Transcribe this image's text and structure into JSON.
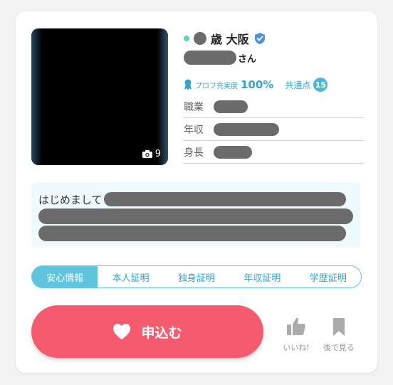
{
  "profile": {
    "age_location": "歳 大阪",
    "name_suffix": "さん",
    "photo_count": "9",
    "completeness_label": "プロフ充実度",
    "completeness_value": "100%",
    "common_label": "共通点",
    "common_count": "15",
    "attributes": [
      {
        "label": "職業"
      },
      {
        "label": "年収"
      },
      {
        "label": "身長"
      }
    ],
    "intro_start": "はじめまして"
  },
  "certifications": {
    "tabs": [
      {
        "label": "安心情報",
        "active": true
      },
      {
        "label": "本人証明",
        "active": false
      },
      {
        "label": "独身証明",
        "active": false
      },
      {
        "label": "年収証明",
        "active": false
      },
      {
        "label": "学歴証明",
        "active": false
      }
    ]
  },
  "actions": {
    "apply_label": "申込む",
    "like_label": "いいね!",
    "later_label": "後で見る"
  },
  "colors": {
    "accent_teal": "#5fc4de",
    "apply_pink": "#f45b6f",
    "online_green": "#5fd4b0",
    "verified_blue": "#4a8fe0"
  }
}
